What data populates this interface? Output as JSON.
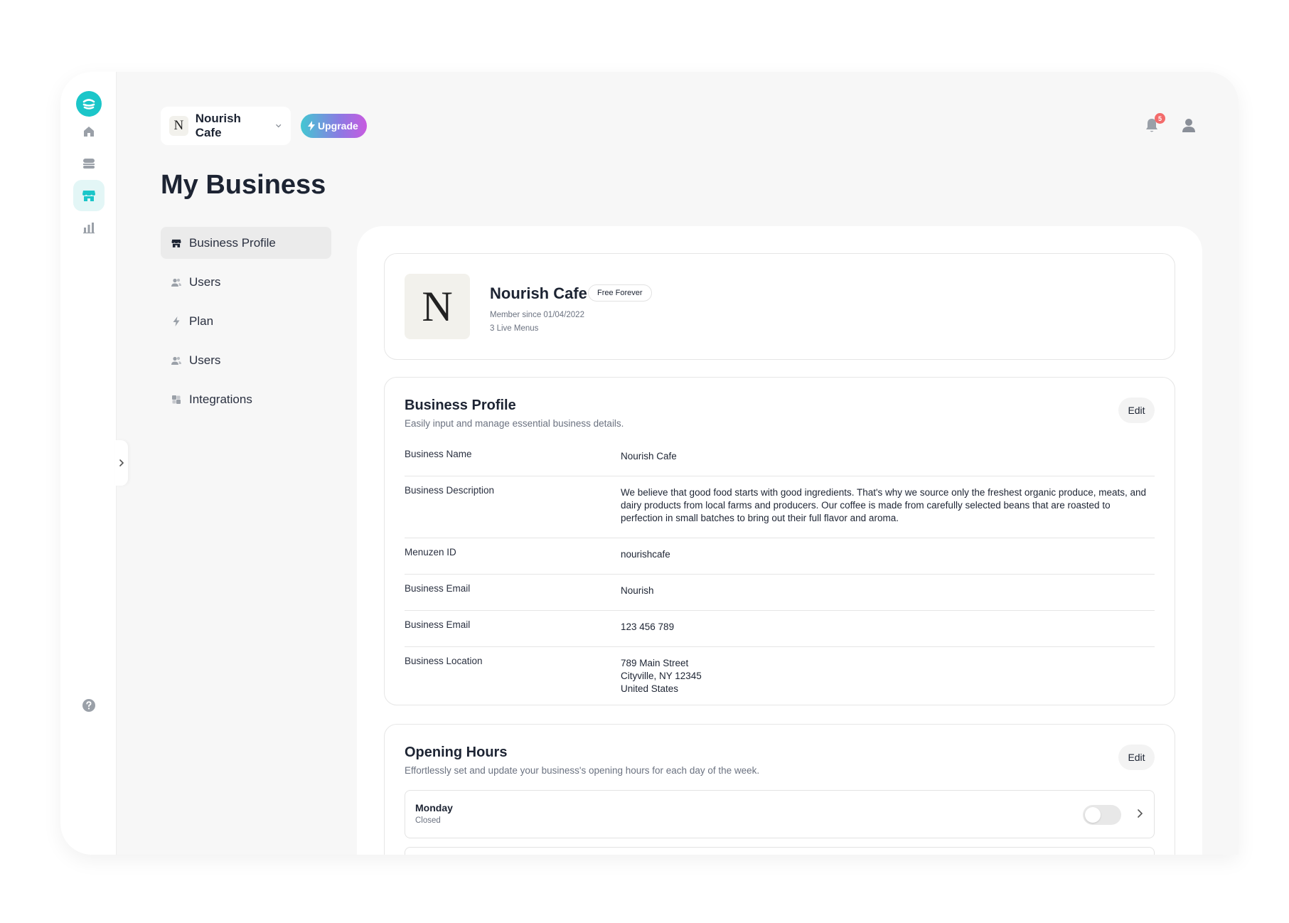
{
  "colors": {
    "accent": "#1bc6c9",
    "badge": "#f36b6b",
    "upgrade_start": "#43c7d2",
    "upgrade_end": "#c85be0"
  },
  "topbar": {
    "business_logo_letter": "N",
    "business_name": "Nourish Cafe",
    "upgrade_label": "Upgrade",
    "notification_count": "5"
  },
  "rail": {
    "icons": [
      "logo-icon",
      "home-icon",
      "menu-icon",
      "store-icon",
      "chart-icon",
      "help-icon",
      "chevron-right-icon"
    ]
  },
  "page": {
    "title": "My Business"
  },
  "subnav": {
    "items": [
      {
        "label": "Business Profile",
        "icon": "store-icon",
        "active": true
      },
      {
        "label": "Users",
        "icon": "users-icon"
      },
      {
        "label": "Plan",
        "icon": "bolt-icon"
      },
      {
        "label": "Users",
        "icon": "users-icon"
      },
      {
        "label": "Integrations",
        "icon": "puzzle-icon"
      }
    ]
  },
  "header_card": {
    "logo_letter": "N",
    "name": "Nourish Cafe",
    "plan": "Free Forever",
    "member_since": "Member since 01/04/2022",
    "live_menus": "3 Live Menus"
  },
  "profile": {
    "title": "Business Profile",
    "subtitle": "Easily input and manage essential business details.",
    "edit_label": "Edit",
    "rows": [
      {
        "label": "Business Name",
        "value": "Nourish Cafe"
      },
      {
        "label": "Business Description",
        "value": "We believe that good food starts with good ingredients. That's why we source only the freshest organic produce, meats, and dairy products from local farms and producers. Our coffee is made from carefully selected beans that are roasted to perfection in small batches to bring out their full flavor and aroma."
      },
      {
        "label": "Menuzen ID",
        "value": "nourishcafe"
      },
      {
        "label": "Business Email",
        "value": "Nourish"
      },
      {
        "label": "Business Email",
        "value": "123 456 789"
      },
      {
        "label": "Business Location",
        "value": "789 Main Street\nCityville, NY 12345\nUnited States"
      }
    ]
  },
  "hours": {
    "title": "Opening Hours",
    "subtitle": "Effortlessly set and update your business's opening hours for each day of the week.",
    "edit_label": "Edit",
    "days": [
      {
        "name": "Monday",
        "status": "Closed",
        "open": false
      }
    ]
  }
}
